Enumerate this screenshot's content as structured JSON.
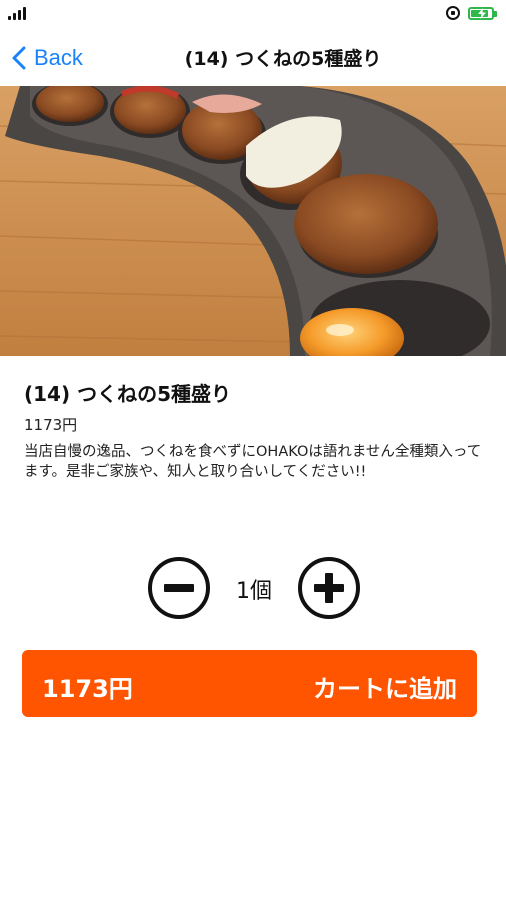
{
  "status_bar": {
    "signal_icon": "cellular-signal-icon",
    "rotation_icon": "rotation-lock-icon",
    "battery_icon": "battery-charging-icon",
    "battery_level": 0.85
  },
  "nav": {
    "back_label": "Back",
    "title": "(14) つくねの5種盛り"
  },
  "product": {
    "name": "(14) つくねの5種盛り",
    "price": "1173円",
    "description": "当店自慢の逸品、つくねを食べずにOHAKOは語れません全種類入ってます。是非ご家族や、知人と取り合いしてください!!"
  },
  "quantity": {
    "value": "1個",
    "minus_icon": "minus-circle-icon",
    "plus_icon": "plus-circle-icon"
  },
  "cart": {
    "price": "1173円",
    "label": "カートに追加"
  },
  "colors": {
    "accent_blue": "#1a82fb",
    "cart_orange": "#ff5500",
    "battery_green": "#2fb84a"
  }
}
